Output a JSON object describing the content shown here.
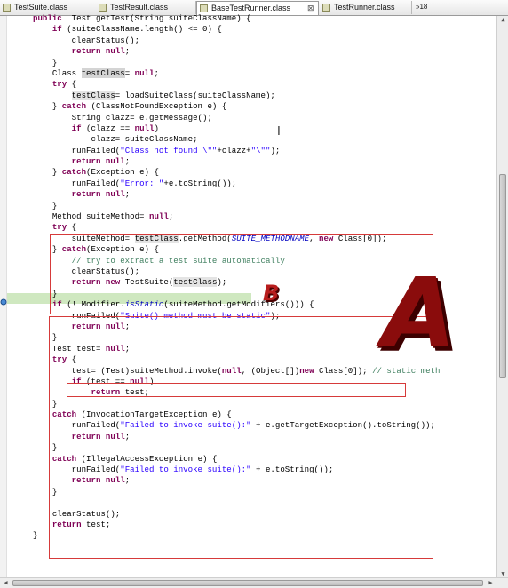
{
  "tabs": [
    {
      "label": "TestSuite.class"
    },
    {
      "label": "TestResult.class"
    },
    {
      "label": "BaseTestRunner.class",
      "close": "⊠"
    },
    {
      "label": "TestRunner.class"
    }
  ],
  "tab_overflow": "»18",
  "annotations": {
    "a": "A",
    "b": "B"
  },
  "code_lines": [
    {
      "text": "public Test getTest(String suiteClassName) {"
    },
    {
      "text": "    if (suiteClassName.length() <= 0) {"
    },
    {
      "text": "        clearStatus();"
    },
    {
      "text": "        return null;"
    },
    {
      "text": "    }"
    },
    {
      "text": "    Class testClass= null;"
    },
    {
      "text": "    try {"
    },
    {
      "text": "        testClass= loadSuiteClass(suiteClassName);"
    },
    {
      "text": "    } catch (ClassNotFoundException e) {"
    },
    {
      "text": "        String clazz= e.getMessage();"
    },
    {
      "text": "        if (clazz == null)"
    },
    {
      "text": "            clazz= suiteClassName;"
    },
    {
      "text": "        runFailed(\"Class not found \\\"\"+clazz+\"\\\"\");"
    },
    {
      "text": "        return null;"
    },
    {
      "text": "    } catch(Exception e) {"
    },
    {
      "text": "        runFailed(\"Error: \"+e.toString());"
    },
    {
      "text": "        return null;"
    },
    {
      "text": "    }"
    },
    {
      "text": "    Method suiteMethod= null;"
    },
    {
      "text": "    try {"
    },
    {
      "text": "        suiteMethod= testClass.getMethod(SUITE_METHODNAME, new Class[0]);"
    },
    {
      "text": "    } catch(Exception e) {"
    },
    {
      "text": "        // try to extract a test suite automatically"
    },
    {
      "text": "        clearStatus();"
    },
    {
      "text": "        return new TestSuite(testClass);"
    },
    {
      "text": "    }"
    },
    {
      "text": "    if (! Modifier.isStatic(suiteMethod.getModifiers())) {"
    },
    {
      "text": "        runFailed(\"Suite() method must be static\");"
    },
    {
      "text": "        return null;"
    },
    {
      "text": "    }"
    },
    {
      "text": "    Test test= null;"
    },
    {
      "text": "    try {"
    },
    {
      "text": "        test= (Test)suiteMethod.invoke(null, (Object[])new Class[0]); // static meth"
    },
    {
      "text": "        if (test == null)"
    },
    {
      "text": "            return test;"
    },
    {
      "text": "    }"
    },
    {
      "text": "    catch (InvocationTargetException e) {"
    },
    {
      "text": "        runFailed(\"Failed to invoke suite():\" + e.getTargetException().toString());"
    },
    {
      "text": "        return null;"
    },
    {
      "text": "    }"
    },
    {
      "text": "    catch (IllegalAccessException e) {"
    },
    {
      "text": "        runFailed(\"Failed to invoke suite():\" + e.toString());"
    },
    {
      "text": "        return null;"
    },
    {
      "text": "    }"
    },
    {
      "text": ""
    },
    {
      "text": "    clearStatus();"
    },
    {
      "text": "    return test;"
    },
    {
      "text": "}"
    }
  ],
  "code_segments": [
    [
      [
        "kw",
        "public"
      ],
      [
        "",
        "  Test getTest(String suiteClassName) {"
      ]
    ],
    [
      [
        "",
        "    "
      ],
      [
        "kw",
        "if"
      ],
      [
        "",
        " (suiteClassName.length() <= 0) {"
      ]
    ],
    [
      [
        "",
        "        clearStatus();"
      ]
    ],
    [
      [
        "",
        "        "
      ],
      [
        "kw",
        "return"
      ],
      [
        "",
        " "
      ],
      [
        "kw",
        "null"
      ],
      [
        "",
        ";"
      ]
    ],
    [
      [
        "",
        "    }"
      ]
    ],
    [
      [
        "",
        "    Class "
      ],
      [
        "occ",
        "testClass"
      ],
      [
        "",
        "= "
      ],
      [
        "kw",
        "null"
      ],
      [
        "",
        ";"
      ]
    ],
    [
      [
        "",
        "    "
      ],
      [
        "kw",
        "try"
      ],
      [
        "",
        " {"
      ]
    ],
    [
      [
        "",
        "        "
      ],
      [
        "occ2",
        "testClass"
      ],
      [
        "",
        "= loadSuiteClass(suiteClassName);"
      ]
    ],
    [
      [
        "",
        "    } "
      ],
      [
        "kw",
        "catch"
      ],
      [
        "",
        " (ClassNotFoundException e) {"
      ]
    ],
    [
      [
        "",
        "        String clazz= e.getMessage();"
      ]
    ],
    [
      [
        "",
        "        "
      ],
      [
        "kw",
        "if"
      ],
      [
        "",
        " (clazz == "
      ],
      [
        "kw",
        "null"
      ],
      [
        "",
        ")"
      ]
    ],
    [
      [
        "",
        "            clazz= suiteClassName;"
      ]
    ],
    [
      [
        "",
        "        runFailed("
      ],
      [
        "str",
        "\"Class not found \\\"\""
      ],
      [
        "",
        "+clazz+"
      ],
      [
        "str",
        "\"\\\"\""
      ],
      [
        "",
        ");"
      ]
    ],
    [
      [
        "",
        "        "
      ],
      [
        "kw",
        "return"
      ],
      [
        "",
        " "
      ],
      [
        "kw",
        "null"
      ],
      [
        "",
        ";"
      ]
    ],
    [
      [
        "",
        "    } "
      ],
      [
        "kw",
        "catch"
      ],
      [
        "",
        "(Exception e) {"
      ]
    ],
    [
      [
        "",
        "        runFailed("
      ],
      [
        "str",
        "\"Error: \""
      ],
      [
        "",
        "+e.toString());"
      ]
    ],
    [
      [
        "",
        "        "
      ],
      [
        "kw",
        "return"
      ],
      [
        "",
        " "
      ],
      [
        "kw",
        "null"
      ],
      [
        "",
        ";"
      ]
    ],
    [
      [
        "",
        "    }"
      ]
    ],
    [
      [
        "",
        "    Method suiteMethod= "
      ],
      [
        "kw",
        "null"
      ],
      [
        "",
        ";"
      ]
    ],
    [
      [
        "",
        "    "
      ],
      [
        "kw",
        "try"
      ],
      [
        "",
        " {"
      ]
    ],
    [
      [
        "",
        "        suiteMethod= "
      ],
      [
        "occ2",
        "testClass"
      ],
      [
        "",
        ".getMethod("
      ],
      [
        "it",
        "SUITE_METHODNAME"
      ],
      [
        "",
        ", "
      ],
      [
        "kw",
        "new"
      ],
      [
        "",
        " Class[0]);"
      ]
    ],
    [
      [
        "",
        "    } "
      ],
      [
        "kw",
        "catch"
      ],
      [
        "",
        "(Exception e) {"
      ]
    ],
    [
      [
        "cm",
        "        // try to extract a test suite automatically"
      ]
    ],
    [
      [
        "",
        "        clearStatus();"
      ]
    ],
    [
      [
        "",
        "        "
      ],
      [
        "kw",
        "return"
      ],
      [
        "",
        " "
      ],
      [
        "kw",
        "new"
      ],
      [
        "",
        " TestSuite("
      ],
      [
        "occ2",
        "testClass"
      ],
      [
        "",
        ");"
      ]
    ],
    [
      [
        "",
        "    }"
      ]
    ],
    [
      [
        "",
        "    "
      ],
      [
        "kw",
        "if"
      ],
      [
        "",
        " (! Modifier."
      ],
      [
        "it",
        "isStatic"
      ],
      [
        "",
        "(suiteMethod.getModifiers())) {"
      ]
    ],
    [
      [
        "",
        "        runFailed("
      ],
      [
        "str",
        "\"Suite() method must be static\""
      ],
      [
        "",
        ");"
      ]
    ],
    [
      [
        "",
        "        "
      ],
      [
        "kw",
        "return"
      ],
      [
        "",
        " "
      ],
      [
        "kw",
        "null"
      ],
      [
        "",
        ";"
      ]
    ],
    [
      [
        "",
        "    }"
      ]
    ],
    [
      [
        "",
        "    Test test= "
      ],
      [
        "kw",
        "null"
      ],
      [
        "",
        ";"
      ]
    ],
    [
      [
        "",
        "    "
      ],
      [
        "kw",
        "try"
      ],
      [
        "",
        " {"
      ]
    ],
    [
      [
        "",
        "        test= (Test)suiteMethod.invoke("
      ],
      [
        "kw",
        "null"
      ],
      [
        "",
        ", (Object[])"
      ],
      [
        "kw",
        "new"
      ],
      [
        "",
        " Class[0]); "
      ],
      [
        "cm",
        "// static meth"
      ]
    ],
    [
      [
        "",
        "        "
      ],
      [
        "kw",
        "if"
      ],
      [
        "",
        " (test == "
      ],
      [
        "kw",
        "null"
      ],
      [
        "",
        ")"
      ]
    ],
    [
      [
        "",
        "            "
      ],
      [
        "kw",
        "return"
      ],
      [
        "",
        " test;"
      ]
    ],
    [
      [
        "",
        "    }"
      ]
    ],
    [
      [
        "",
        "    "
      ],
      [
        "kw",
        "catch"
      ],
      [
        "",
        " (InvocationTargetException e) {"
      ]
    ],
    [
      [
        "",
        "        runFailed("
      ],
      [
        "str",
        "\"Failed to invoke suite():\""
      ],
      [
        "",
        " + e.getTargetException().toString());"
      ]
    ],
    [
      [
        "",
        "        "
      ],
      [
        "kw",
        "return"
      ],
      [
        "",
        " "
      ],
      [
        "kw",
        "null"
      ],
      [
        "",
        ";"
      ]
    ],
    [
      [
        "",
        "    }"
      ]
    ],
    [
      [
        "",
        "    "
      ],
      [
        "kw",
        "catch"
      ],
      [
        "",
        " (IllegalAccessException e) {"
      ]
    ],
    [
      [
        "",
        "        runFailed("
      ],
      [
        "str",
        "\"Failed to invoke suite():\""
      ],
      [
        "",
        " + e.toString());"
      ]
    ],
    [
      [
        "",
        "        "
      ],
      [
        "kw",
        "return"
      ],
      [
        "",
        " "
      ],
      [
        "kw",
        "null"
      ],
      [
        "",
        ";"
      ]
    ],
    [
      [
        "",
        "    }"
      ]
    ],
    [
      [
        "",
        ""
      ]
    ],
    [
      [
        "",
        "    clearStatus();"
      ]
    ],
    [
      [
        "",
        "    "
      ],
      [
        "kw",
        "return"
      ],
      [
        "",
        " test;"
      ]
    ],
    [
      [
        "",
        "}"
      ]
    ]
  ],
  "colors": {
    "keyword": "#7f0055",
    "string": "#2a00ff",
    "comment": "#3f7f5f",
    "highlight_box": "#d63a3a",
    "current_line": "#cfe8c0",
    "label": "#8a0c0c"
  }
}
